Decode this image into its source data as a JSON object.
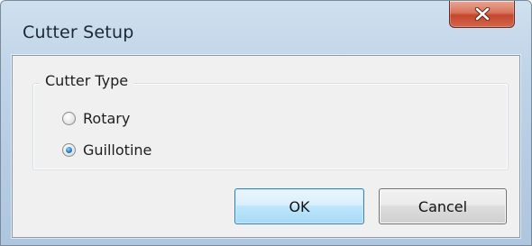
{
  "window": {
    "title": "Cutter Setup",
    "close_glyph": "close-icon"
  },
  "group": {
    "label": "Cutter Type",
    "options": [
      {
        "label": "Rotary",
        "checked": false
      },
      {
        "label": "Guillotine",
        "checked": true
      }
    ]
  },
  "buttons": {
    "ok_label": "OK",
    "cancel_label": "Cancel"
  },
  "colors": {
    "titlebar": "#bfd4e8",
    "client": "#f0f0f0",
    "close": "#c4462c",
    "ok_border": "#3c7fb1"
  }
}
